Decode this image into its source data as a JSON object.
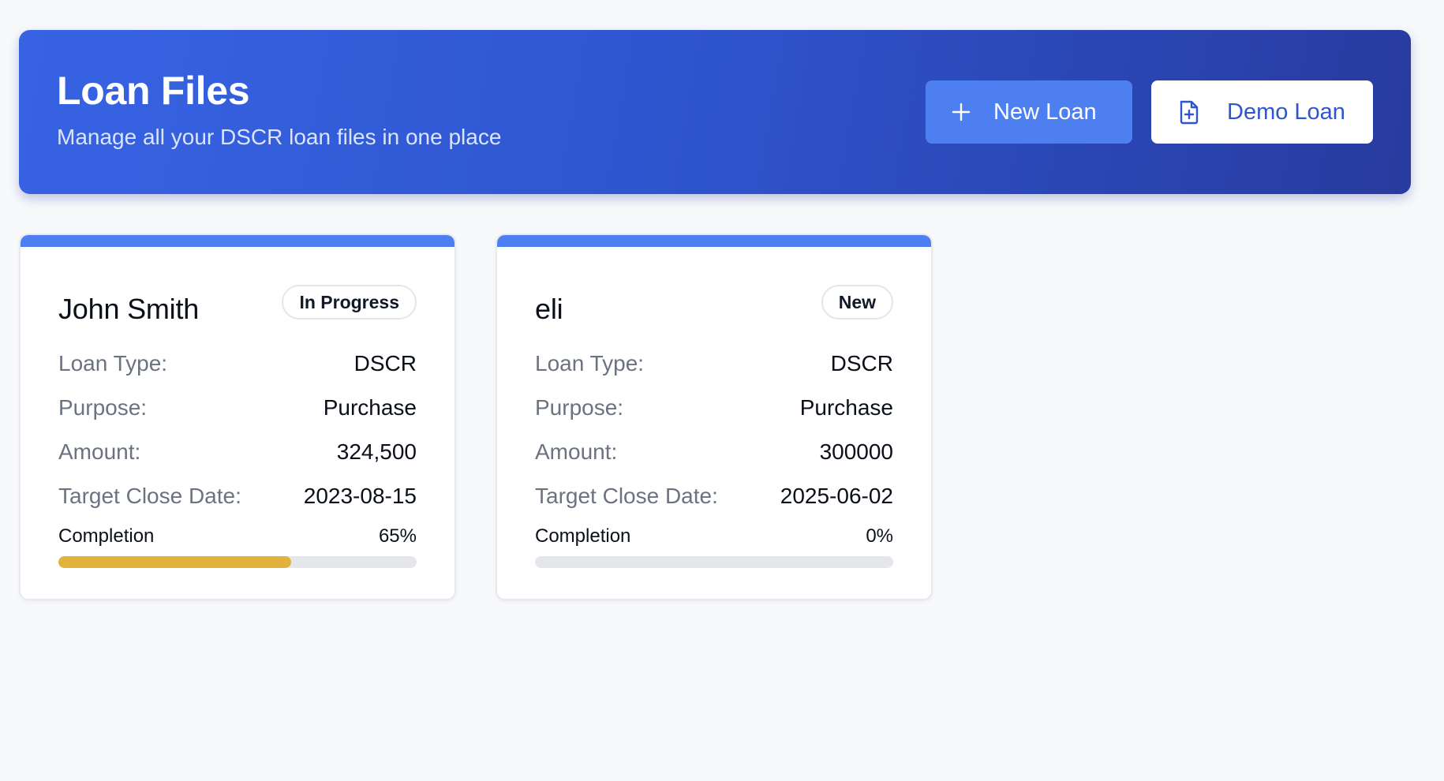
{
  "header": {
    "title": "Loan Files",
    "subtitle": "Manage all your DSCR loan files in one place",
    "new_loan_label": "New Loan",
    "new_loan_icon": "plus-icon",
    "demo_loan_label": "Demo Loan",
    "demo_loan_icon": "file-plus-icon"
  },
  "labels": {
    "loan_type": "Loan Type:",
    "purpose": "Purpose:",
    "amount": "Amount:",
    "target_close_date": "Target Close Date:",
    "completion": "Completion"
  },
  "cards": [
    {
      "name": "John Smith",
      "status": "In Progress",
      "loan_type": "DSCR",
      "purpose": "Purchase",
      "amount": "324,500",
      "target_close_date": "2023-08-15",
      "completion_text": "65%",
      "completion": 0.65
    },
    {
      "name": "eli",
      "status": "New",
      "loan_type": "DSCR",
      "purpose": "Purchase",
      "amount": "300000",
      "target_close_date": "2025-06-02",
      "completion_text": "0%",
      "completion": 0
    }
  ],
  "colors": {
    "brand": "#3763e3",
    "accent": "#4e7ff0",
    "progress": "#e2b33c"
  }
}
